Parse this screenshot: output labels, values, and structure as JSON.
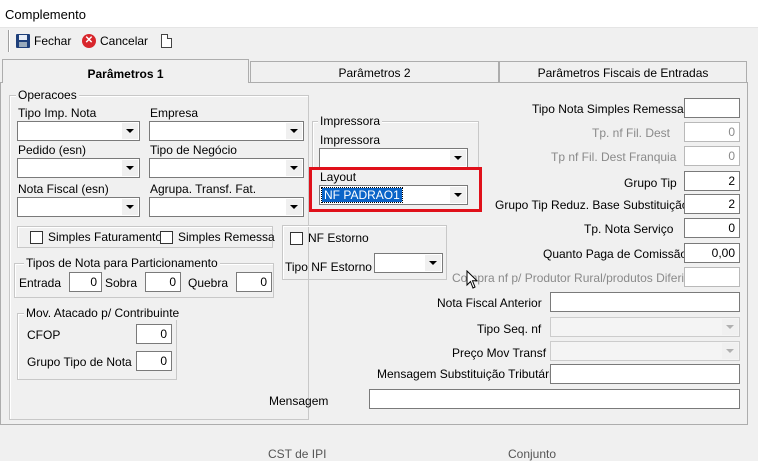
{
  "window": {
    "title": "Complemento"
  },
  "toolbar": {
    "fechar": "Fechar",
    "cancelar": "Cancelar"
  },
  "tabs": [
    "Parâmetros 1",
    "Parâmetros 2",
    "Parâmetros Fiscais de Entradas"
  ],
  "operacoes": {
    "legend": "Operacoes",
    "tipo_imp_nota": {
      "label": "Tipo Imp. Nota",
      "value": ""
    },
    "empresa": {
      "label": "Empresa",
      "value": ""
    },
    "pedido": {
      "label": "Pedido (esn)",
      "value": ""
    },
    "tipo_negocio": {
      "label": "Tipo de Negócio",
      "value": ""
    },
    "nota_fiscal": {
      "label": "Nota Fiscal (esn)",
      "value": ""
    },
    "agrupa": {
      "label": "Agrupa. Transf. Fat.",
      "value": ""
    }
  },
  "impressora": {
    "legend": "Impressora",
    "label": "Impressora",
    "value": "",
    "layout_label": "Layout",
    "layout_value": "NF PADRAO1"
  },
  "checks": {
    "simples_faturamento": "Simples Faturamento",
    "simples_remessa": "Simples Remessa",
    "nf_estorno": "NF Estorno",
    "tipo_nf_estorno": "Tipo NF Estorno"
  },
  "particionamento": {
    "legend": "Tipos de Nota para Particionamento",
    "entrada_label": "Entrada",
    "entrada_value": "0",
    "sobra_label": "Sobra",
    "sobra_value": "0",
    "quebra_label": "Quebra",
    "quebra_value": "0"
  },
  "mov_atacado": {
    "legend": "Mov. Atacado p/ Contribuinte",
    "cfop_label": "CFOP",
    "cfop_value": "0",
    "grupo_label": "Grupo Tipo de Nota",
    "grupo_value": "0"
  },
  "right": {
    "tipo_nota_simples_remessa": {
      "label": "Tipo Nota Simples Remessa",
      "value": ""
    },
    "tp_nf_fil_dest": {
      "label": "Tp. nf Fil. Dest",
      "value": "0"
    },
    "tp_nf_fil_dest_franquia": {
      "label": "Tp nf Fil. Dest Franquia",
      "value": "0"
    },
    "grupo_tip": {
      "label": "Grupo Tip",
      "value": "2"
    },
    "grupo_tip_reduz": {
      "label": "Grupo Tip Reduz. Base Substituição",
      "value": "2"
    },
    "tp_nota_servico": {
      "label": "Tp. Nota Serviço",
      "value": "0"
    },
    "quanto_paga_comissao": {
      "label": "Quanto Paga de Comissão",
      "value": "0,00"
    },
    "compra_nf_produtor": {
      "label": "Compra nf p/ Produtor Rural/produtos Diferidos",
      "value": ""
    },
    "nota_fiscal_anterior": {
      "label": "Nota Fiscal Anterior",
      "value": ""
    },
    "tipo_seq_nf": {
      "label": "Tipo Seq. nf",
      "value": ""
    },
    "preco_mov_transf": {
      "label": "Preço Mov Transf",
      "value": ""
    },
    "mensagem_subst": {
      "label": "Mensagem Substituição Tributária",
      "value": ""
    }
  },
  "mensagem": {
    "label": "Mensagem",
    "value": ""
  },
  "bottom_partial": [
    "CST de IPI",
    "Conjunto"
  ]
}
